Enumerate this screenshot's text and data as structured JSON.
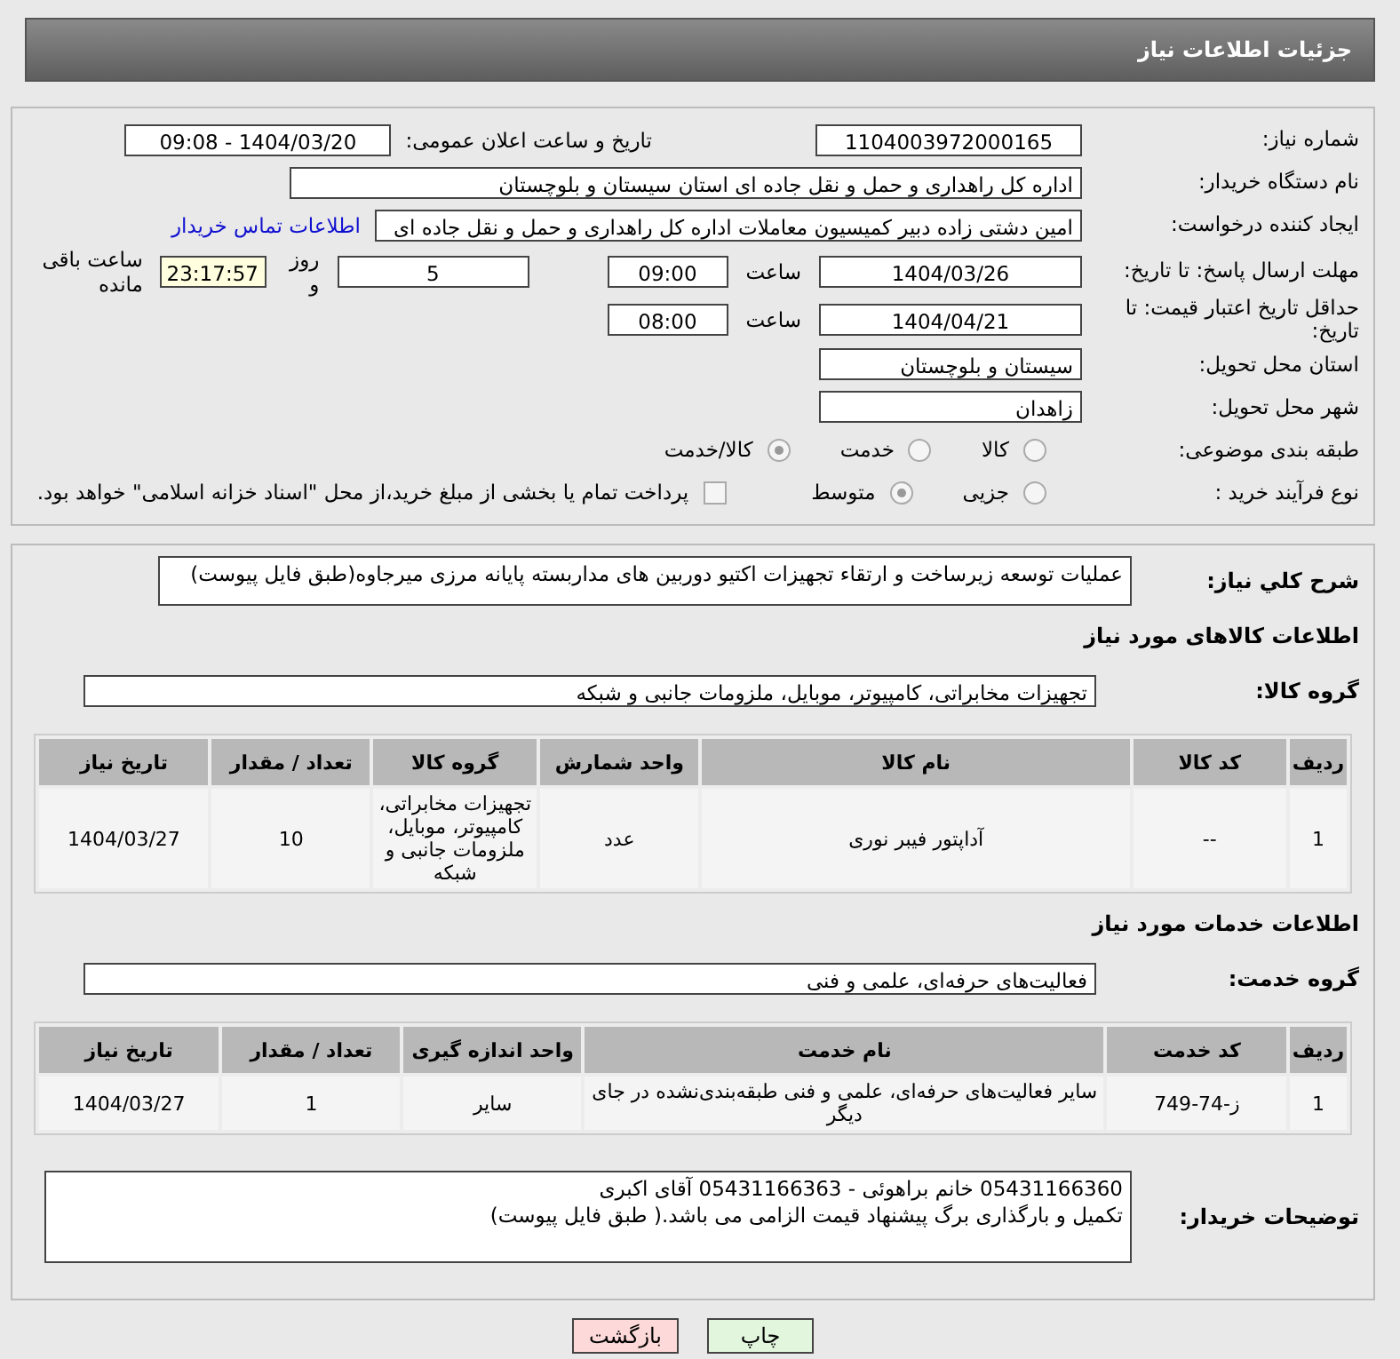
{
  "header": {
    "title": "جزئیات اطلاعات نیاز"
  },
  "need_number": {
    "label": "شماره نیاز:",
    "value": "1104003972000165"
  },
  "announce": {
    "label": "تاریخ و ساعت اعلان عمومی:",
    "value": "1404/03/20 - 09:08"
  },
  "buyer_org": {
    "label": "نام دستگاه خریدار:",
    "value": "اداره کل راهداری و حمل و نقل جاده ای استان سیستان و بلوچستان"
  },
  "requester": {
    "label": "ایجاد کننده درخواست:",
    "value": "امین دشتی زاده دبیر کمیسیون معاملات اداره کل راهداری و حمل و نقل جاده ای",
    "link": "اطلاعات تماس خریدار"
  },
  "reply_deadline": {
    "label": "مهلت ارسال پاسخ: تا تاریخ:",
    "date": "1404/03/26",
    "time_label": "ساعت",
    "time": "09:00",
    "days": "5",
    "days_label": "روز و",
    "remaining": "23:17:57",
    "remaining_label": "ساعت باقی مانده"
  },
  "price_validity": {
    "label": "حداقل تاریخ اعتبار قیمت: تا تاریخ:",
    "date": "1404/04/21",
    "time_label": "ساعت",
    "time": "08:00"
  },
  "province": {
    "label": "استان محل تحویل:",
    "value": "سیستان و بلوچستان"
  },
  "city": {
    "label": "شهر محل تحویل:",
    "value": "زاهدان"
  },
  "category": {
    "label": "طبقه بندی موضوعی:",
    "options": [
      {
        "label": "کالا",
        "selected": false
      },
      {
        "label": "خدمت",
        "selected": false
      },
      {
        "label": "کالا/خدمت",
        "selected": true
      }
    ]
  },
  "purchase_type": {
    "label": "نوع فرآیند خرید :",
    "options": [
      {
        "label": "جزیی",
        "selected": false
      },
      {
        "label": "متوسط",
        "selected": true
      }
    ],
    "payment": {
      "label": "پرداخت تمام یا بخشی از مبلغ خرید،از محل \"اسناد خزانه اسلامی\" خواهد بود.",
      "checked": false
    }
  },
  "description": {
    "label": "شرح کلي نياز:",
    "value": "عملیات توسعه زیرساخت و ارتقاء تجهیزات اکتیو دوربین های مداربسته پایانه مرزی میرجاوه(طبق فایل پیوست)"
  },
  "goods": {
    "title": "اطلاعات کالاهای مورد نیاز",
    "group_label": "گروه کالا:",
    "group": "تجهیزات مخابراتی، کامپیوتر، موبایل، ملزومات جانبی و شبکه",
    "columns": [
      "ردیف",
      "کد کالا",
      "نام کالا",
      "واحد شمارش",
      "گروه کالا",
      "تعداد / مقدار",
      "تاریخ نیاز"
    ],
    "rows": [
      [
        "1",
        "--",
        "آداپتور فیبر نوری",
        "عدد",
        "تجهیزات مخابراتی، کامپیوتر، موبایل، ملزومات جانبی و شبکه",
        "10",
        "1404/03/27"
      ]
    ]
  },
  "services": {
    "title": "اطلاعات خدمات مورد نیاز",
    "group_label": "گروه خدمت:",
    "group": "فعالیت‌های حرفه‌ای، علمی و فنی",
    "columns": [
      "ردیف",
      "کد خدمت",
      "نام خدمت",
      "واحد اندازه گیری",
      "تعداد / مقدار",
      "تاریخ نیاز"
    ],
    "rows": [
      [
        "1",
        "ز-74-749",
        "سایر فعالیت‌های حرفه‌ای، علمی و فنی طبقه‌بندی‌نشده در جای دیگر",
        "سایر",
        "1",
        "1404/03/27"
      ]
    ]
  },
  "buyer_notes": {
    "label": "توضیحات خریدار:",
    "lines": [
      "05431166360 خانم براهوئی - 05431166363 آقای اکبری",
      "تکمیل و بارگذاری برگ پیشنهاد قیمت الزامی می باشد.( طبق فایل پیوست)"
    ]
  },
  "buttons": [
    {
      "label": "چاپ",
      "kind": "print"
    },
    {
      "label": "بازگشت",
      "kind": "back"
    }
  ]
}
